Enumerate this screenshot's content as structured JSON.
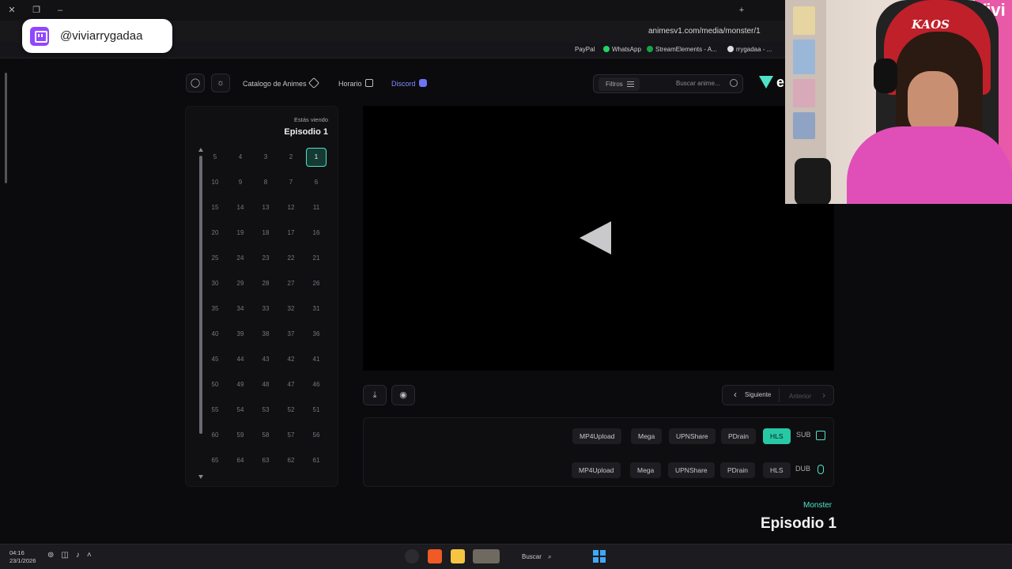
{
  "twitch": {
    "handle": "@viviarrygadaa"
  },
  "browser": {
    "url": "animesv1.com/media/monster/1",
    "bookmarks": [
      "PayPal",
      "WhatsApp",
      "StreamElements - A...",
      "rrygadaa - ..."
    ]
  },
  "webcam": {
    "chair_text": "KAOS",
    "wall_text": "Vivi"
  },
  "site": {
    "logo": "e",
    "search_placeholder": "Buscar anime...",
    "filters_label": "Filtros",
    "nav": {
      "catalog": "Catalogo de Animes",
      "schedule": "Horario",
      "discord": "Discord"
    }
  },
  "panel": {
    "watching_label": "Estás viendo",
    "current_episode": "Episodio 1",
    "episodes": [
      "1",
      "2",
      "3",
      "4",
      "5",
      "6",
      "7",
      "8",
      "9",
      "10",
      "11",
      "12",
      "13",
      "14",
      "15",
      "16",
      "17",
      "18",
      "19",
      "20",
      "21",
      "22",
      "23",
      "24",
      "25",
      "26",
      "27",
      "28",
      "29",
      "30",
      "31",
      "32",
      "33",
      "34",
      "35",
      "36",
      "37",
      "38",
      "39",
      "40",
      "41",
      "42",
      "43",
      "44",
      "45",
      "46",
      "47",
      "48",
      "49",
      "50",
      "51",
      "52",
      "53",
      "54",
      "55",
      "56",
      "57",
      "58",
      "59",
      "60",
      "61",
      "62",
      "63",
      "64",
      "65"
    ],
    "current_index": 0
  },
  "episode_nav": {
    "next": "Siguiente",
    "prev": "Anterior"
  },
  "servers": {
    "sub": {
      "label": "SUB",
      "buttons": [
        "HLS",
        "PDrain",
        "UPNShare",
        "Mega",
        "MP4Upload"
      ],
      "active": "HLS"
    },
    "dub": {
      "label": "DUB",
      "buttons": [
        "HLS",
        "PDrain",
        "UPNShare",
        "Mega",
        "MP4Upload"
      ],
      "active": ""
    }
  },
  "meta": {
    "series": "Monster",
    "episode": "Episodio 1"
  },
  "taskbar": {
    "time": "04:16",
    "date": "23/1/2026",
    "search": "Buscar"
  },
  "colors": {
    "accent": "#4ee3c6",
    "active_btn": "#27c9a4",
    "discord": "#7f8cff",
    "twitch": "#9146ff"
  }
}
